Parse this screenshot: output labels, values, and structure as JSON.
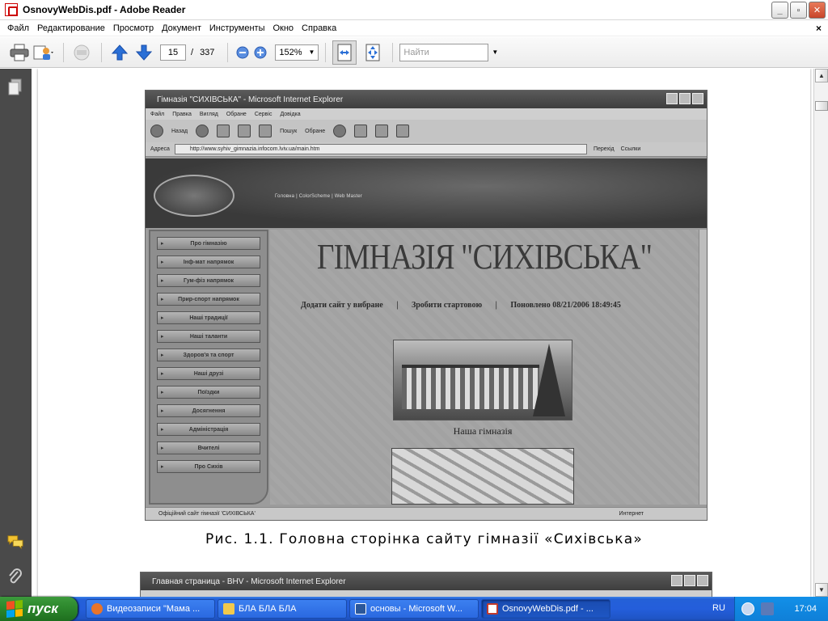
{
  "window": {
    "title": "OsnovyWebDis.pdf - Adobe Reader",
    "controls": {
      "minimize": "_",
      "maximize": "▫",
      "close": "✕"
    }
  },
  "menu": {
    "items": [
      "Файл",
      "Редактирование",
      "Просмотр",
      "Документ",
      "Инструменты",
      "Окно",
      "Справка"
    ],
    "close": "×"
  },
  "toolbar": {
    "current_page": "15",
    "page_separator": "/",
    "total_pages": "337",
    "zoom": "152%",
    "find_placeholder": "Найти"
  },
  "document": {
    "figure1": {
      "ie_title": "Гімназія \"СИХІВСЬКА\" - Microsoft Internet Explorer",
      "ie_menu": [
        "Файл",
        "Правка",
        "Вигляд",
        "Обране",
        "Сервіс",
        "Довідка"
      ],
      "ie_toolbar": {
        "back": "Назад",
        "search": "Пошук",
        "favorites": "Обране"
      },
      "ie_address_label": "Адреса",
      "ie_address": "http://www.syhiv_gimnazia.infocom.lviv.ua/main.htm",
      "ie_go": "Перехід",
      "ie_links": "Ссылки",
      "banner_nav": "Головна | ColorScheme | Web Master",
      "left_menu": [
        "Про гімназію",
        "Інф-мат напрямок",
        "Гум-фіз напрямок",
        "Приp-спорт напрямок",
        "Наші традиції",
        "Наші таланти",
        "Здоров'я та спорт",
        "Наші друзі",
        "Поїздки",
        "Досягнення",
        "Адміністрація",
        "Вчителі",
        "Про Сихів"
      ],
      "site_title": "ГІМНАЗІЯ \"СИХІВСЬКА\"",
      "site_links": {
        "add_favorites": "Додати сайт у вибране",
        "sep1": "|",
        "make_home": "Зробити стартовою",
        "sep2": "|",
        "updated": "Поновлено 08/21/2006 18:49:45"
      },
      "photo_caption": "Наша гімназія",
      "ie_status": "Офіційний сайт гімназії 'СИХІВСЬКА'",
      "ie_zone": "Интернет"
    },
    "caption": "Рис. 1.1. Головна сторінка сайту гімназії «Сихівська»",
    "figure2": {
      "ie_title": "Главная страница - BHV - Microsoft Internet Explorer"
    }
  },
  "taskbar": {
    "start": "пуск",
    "tasks": [
      {
        "label": "Видеозаписи \"Мама ...",
        "icon_color": "#e8742a"
      },
      {
        "label": "БЛА БЛА БЛА",
        "icon_color": "#f2c94c"
      },
      {
        "label": "основы - Microsoft W...",
        "icon_color": "#2b579a"
      },
      {
        "label": "OsnovyWebDis.pdf - ...",
        "icon_color": "#c0392b"
      }
    ],
    "language": "RU",
    "clock": "17:04"
  },
  "colors": {
    "taskbar_blue": "#245edb",
    "start_green": "#2e8a2e",
    "nav_panel": "#4a4a4a",
    "toolbar_arrow_blue": "#2a6fd6"
  }
}
